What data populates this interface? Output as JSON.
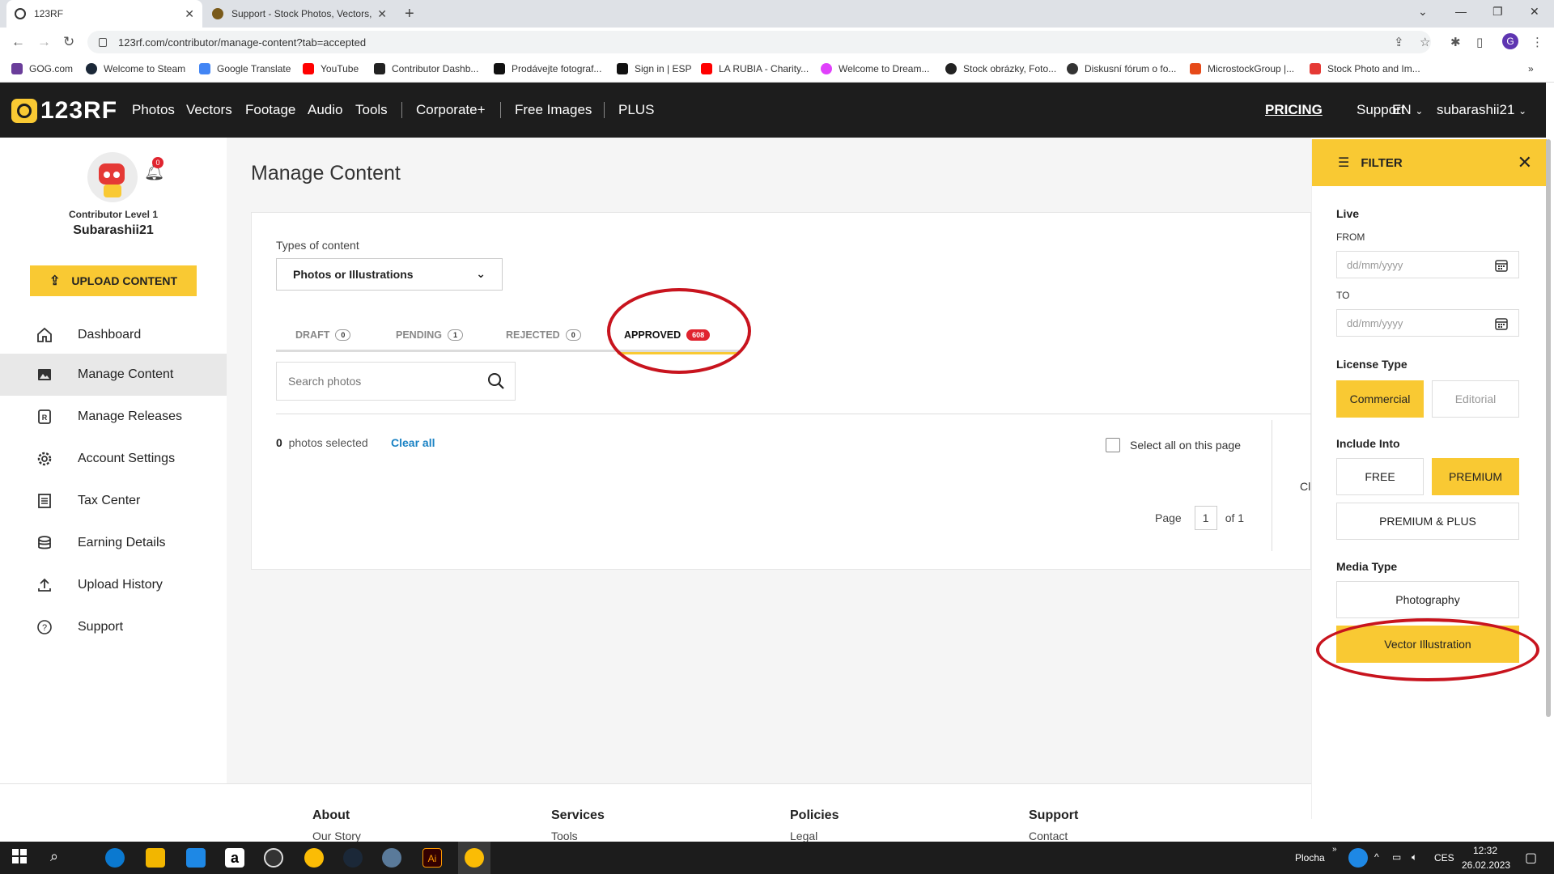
{
  "browser": {
    "tabs": [
      {
        "title": "123RF"
      },
      {
        "title": "Support - Stock Photos, Vectors,"
      }
    ],
    "url": "123rf.com/contributor/manage-content?tab=accepted",
    "bookmarks": [
      {
        "label": "GOG.com"
      },
      {
        "label": "Welcome to Steam"
      },
      {
        "label": "Google Translate"
      },
      {
        "label": "YouTube"
      },
      {
        "label": "Contributor Dashb..."
      },
      {
        "label": "Prodávejte fotograf..."
      },
      {
        "label": "Sign in | ESP"
      },
      {
        "label": "LA RUBIA - Charity..."
      },
      {
        "label": "Welcome to Dream..."
      },
      {
        "label": "Stock obrázky, Foto..."
      },
      {
        "label": "Diskusní fórum o fo..."
      },
      {
        "label": "MicrostockGroup |..."
      },
      {
        "label": "Stock Photo and Im..."
      }
    ],
    "profile_initial": "G"
  },
  "site": {
    "logo": "123RF",
    "nav": [
      "Photos",
      "Vectors",
      "Footage",
      "Audio",
      "Tools",
      "Corporate+",
      "Free Images",
      "PLUS"
    ],
    "right_nav": {
      "pricing": "PRICING",
      "support": "Support",
      "lang": "EN",
      "user": "subarashii21"
    }
  },
  "sidebar": {
    "notification_count": "0",
    "level": "Contributor Level 1",
    "username": "Subarashii21",
    "upload_label": "UPLOAD CONTENT",
    "items": [
      {
        "label": "Dashboard",
        "icon": "home-icon"
      },
      {
        "label": "Manage Content",
        "icon": "image-icon",
        "active": true
      },
      {
        "label": "Manage Releases",
        "icon": "release-icon"
      },
      {
        "label": "Account Settings",
        "icon": "gear-icon"
      },
      {
        "label": "Tax Center",
        "icon": "document-icon"
      },
      {
        "label": "Earning Details",
        "icon": "coins-icon"
      },
      {
        "label": "Upload History",
        "icon": "upload-icon"
      },
      {
        "label": "Support",
        "icon": "help-icon"
      }
    ]
  },
  "main": {
    "title": "Manage Content",
    "types_label": "Types of content",
    "type_selected": "Photos or Illustrations",
    "tabs": [
      {
        "label": "DRAFT",
        "count": "0"
      },
      {
        "label": "PENDING",
        "count": "1"
      },
      {
        "label": "REJECTED",
        "count": "0"
      },
      {
        "label": "APPROVED",
        "count": "608",
        "active": true
      }
    ],
    "search_placeholder": "Search photos",
    "selected_count": "0",
    "selected_text": "photos selected",
    "clear_all": "Clear all",
    "select_all": "Select all on this page",
    "clipped_text": "Cli",
    "pager": {
      "label": "Page",
      "current": "1",
      "of": "of 1"
    }
  },
  "filter": {
    "title": "FILTER",
    "live": "Live",
    "from_label": "FROM",
    "to_label": "TO",
    "date_placeholder": "dd/mm/yyyy",
    "license_type": "License Type",
    "license_options": [
      "Commercial",
      "Editorial"
    ],
    "include_into": "Include Into",
    "include_options": [
      "FREE",
      "PREMIUM",
      "PREMIUM & PLUS"
    ],
    "media_type": "Media Type",
    "media_options": [
      "Photography",
      "Vector Illustration"
    ]
  },
  "footer": {
    "columns": [
      {
        "head": "About",
        "link": "Our Story"
      },
      {
        "head": "Services",
        "link": "Tools"
      },
      {
        "head": "Policies",
        "link": "Legal"
      },
      {
        "head": "Support",
        "link": "Contact"
      }
    ]
  },
  "taskbar": {
    "desktop_label": "Plocha",
    "lang": "CES",
    "time": "12:32",
    "date": "26.02.2023"
  },
  "colors": {
    "brand_yellow": "#f9c933",
    "header_dark": "#1d1d1d",
    "annotation_red": "#c8141e",
    "link_blue": "#1a82c4"
  }
}
